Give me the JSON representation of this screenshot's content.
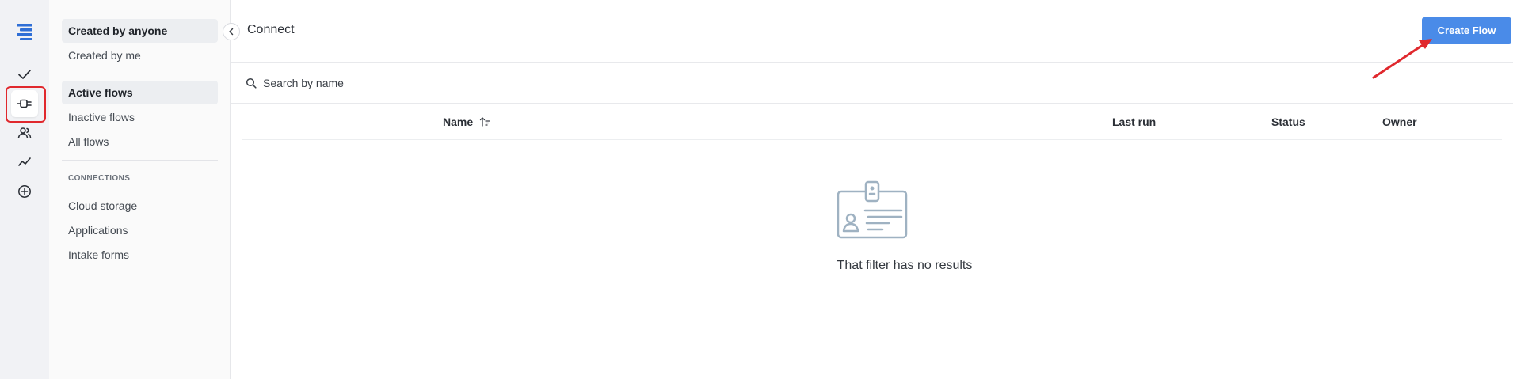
{
  "rail": {
    "items": [
      {
        "name": "app-logo",
        "icon": "logo-stack-icon"
      },
      {
        "name": "tasks",
        "icon": "check-icon"
      },
      {
        "name": "connect",
        "icon": "plug-icon",
        "active": true
      },
      {
        "name": "people",
        "icon": "users-icon"
      },
      {
        "name": "analytics",
        "icon": "trend-line-icon"
      },
      {
        "name": "add",
        "icon": "plus-circle-icon"
      }
    ]
  },
  "sidebar": {
    "owner_filters": [
      "Created by anyone",
      "Created by me"
    ],
    "flow_filters": [
      "Active flows",
      "Inactive flows",
      "All flows"
    ],
    "connections_label": "CONNECTIONS",
    "connections": [
      "Cloud storage",
      "Applications",
      "Intake forms"
    ]
  },
  "header": {
    "title": "Connect",
    "create_label": "Create Flow"
  },
  "search": {
    "placeholder": "Search by name"
  },
  "table": {
    "columns": [
      "Name",
      "Last run",
      "Status",
      "Owner"
    ]
  },
  "empty_state": {
    "message": "That filter has no results"
  },
  "colors": {
    "accent": "#4a8be8",
    "highlight": "#e0282d"
  }
}
